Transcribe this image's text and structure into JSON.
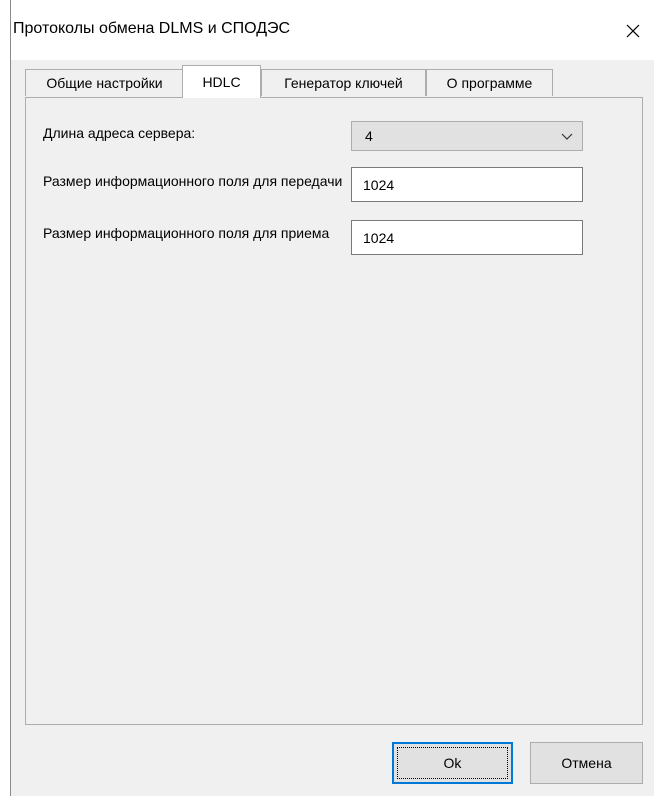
{
  "window": {
    "title": "Протоколы обмена DLMS и СПОДЭС"
  },
  "tabs": [
    {
      "label": "Общие настройки",
      "active": false
    },
    {
      "label": "HDLC",
      "active": true
    },
    {
      "label": "Генератор ключей",
      "active": false
    },
    {
      "label": "О программе",
      "active": false
    }
  ],
  "hdlc": {
    "server_address_length_label": "Длина адреса сервера:",
    "server_address_length_value": "4",
    "tx_info_field_label": "Размер информационного поля для передачи",
    "tx_info_field_value": "1024",
    "rx_info_field_label": "Размер информационного поля для приема",
    "rx_info_field_value": "1024"
  },
  "buttons": {
    "ok_label": "Ok",
    "cancel_label": "Отмена"
  },
  "colors": {
    "window_bg": "#f0f0f0",
    "titlebar_bg": "#ffffff",
    "default_button_border": "#0078d7"
  },
  "icons": {
    "close": "close-icon",
    "dropdown": "chevron-down-icon"
  }
}
